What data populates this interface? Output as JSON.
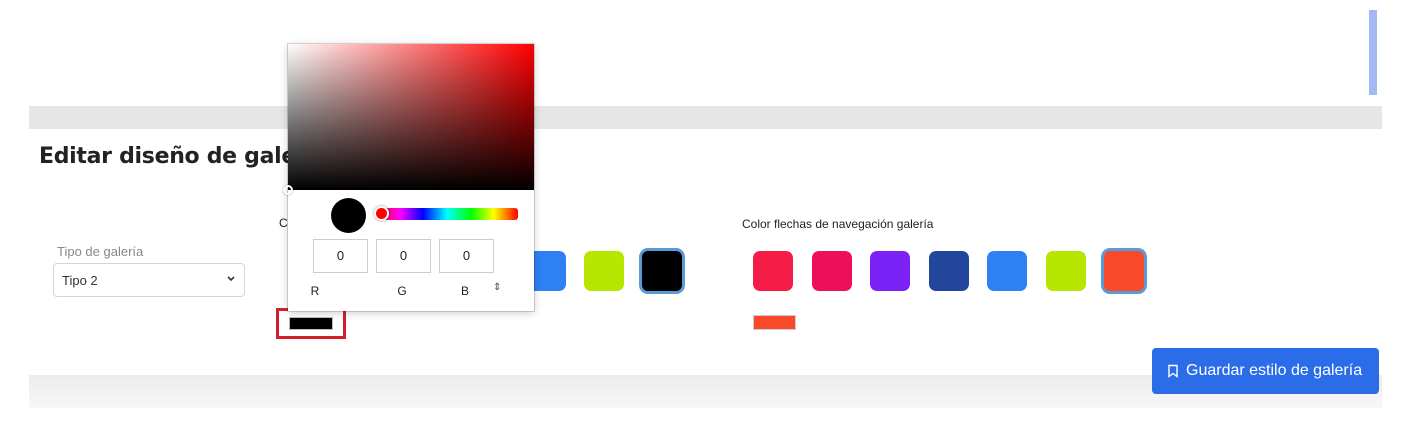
{
  "page": {
    "title": "Editar diseño de galerí"
  },
  "gallery_type": {
    "label": "Tipo de galería",
    "value": "Tipo 2"
  },
  "section_one": {
    "label_partial": "C",
    "visible_swatches": [
      {
        "color": "#2f80f5",
        "selected": false
      },
      {
        "color": "#b7e600",
        "selected": false
      },
      {
        "color": "#000000",
        "selected": true
      }
    ],
    "preview_color": "#000000"
  },
  "nav_arrows": {
    "label": "Color flechas de navegación galería",
    "swatches": [
      {
        "color": "#f51d47",
        "selected": false
      },
      {
        "color": "#ee0f5a",
        "selected": false
      },
      {
        "color": "#7b22f7",
        "selected": false
      },
      {
        "color": "#22469c",
        "selected": false
      },
      {
        "color": "#2f80f5",
        "selected": false
      },
      {
        "color": "#b7e600",
        "selected": false
      },
      {
        "color": "#f84a2a",
        "selected": true
      }
    ],
    "preview_color": "#f84a2a"
  },
  "picker": {
    "hue_color": "#ff0000",
    "current_color": "#000000",
    "r": "0",
    "g": "0",
    "b": "0",
    "r_label": "R",
    "g_label": "G",
    "b_label": "B",
    "mode_toggle": "⇕"
  },
  "save_button": {
    "label": "Guardar estilo de galería",
    "icon": "bookmark-icon"
  }
}
